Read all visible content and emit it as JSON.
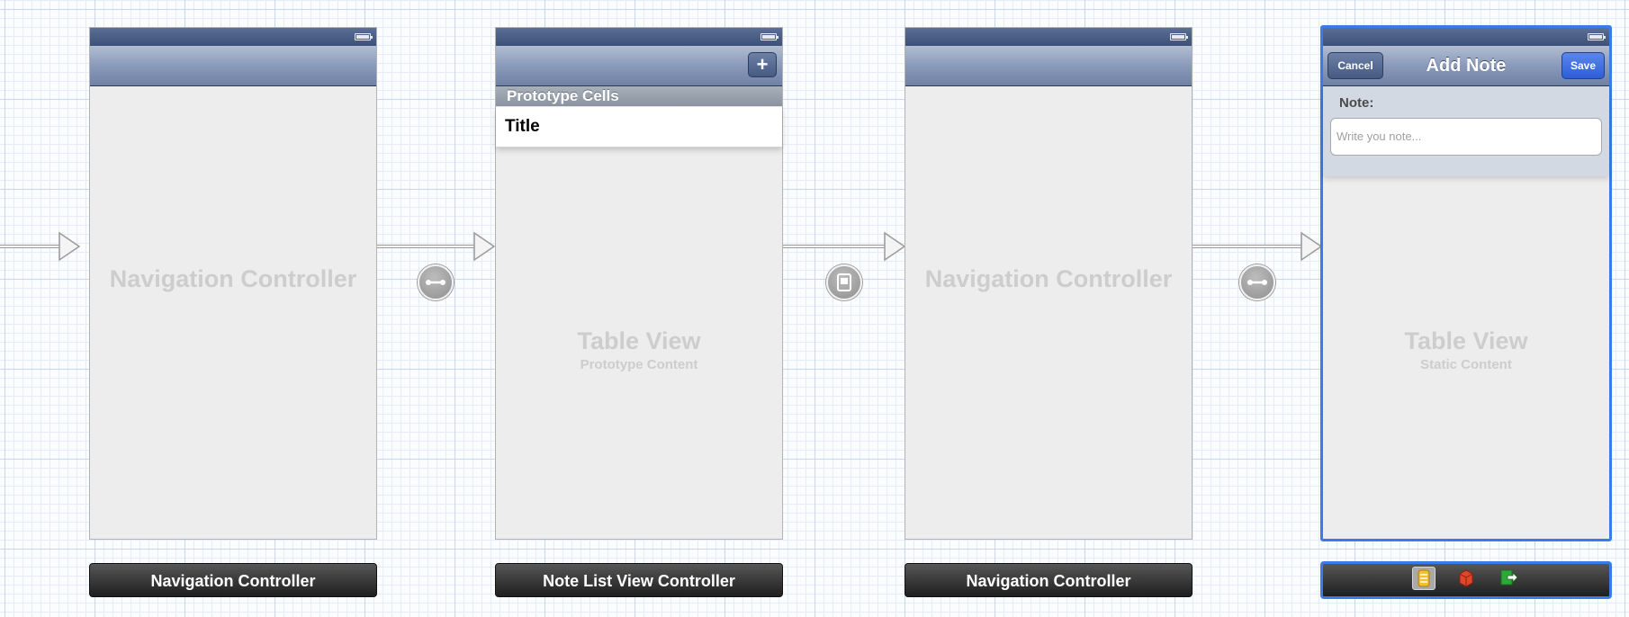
{
  "scenes": {
    "nav1": {
      "center_label": "Navigation Controller",
      "dock_label": "Navigation Controller"
    },
    "notelist": {
      "prototype_header": "Prototype Cells",
      "cell_title": "Title",
      "add_button": "+",
      "table_title": "Table View",
      "table_subtitle": "Prototype Content",
      "dock_label": "Note List View Controller"
    },
    "nav2": {
      "center_label": "Navigation Controller",
      "dock_label": "Navigation Controller"
    },
    "addnote": {
      "nav_title": "Add Note",
      "cancel_label": "Cancel",
      "save_label": "Save",
      "note_label": "Note:",
      "note_placeholder": "Write you note...",
      "table_title": "Table View",
      "table_subtitle": "Static Content"
    }
  },
  "segues": [
    {
      "type": "relationship",
      "icon": "relationship-segue-icon"
    },
    {
      "type": "modal",
      "icon": "modal-segue-icon"
    },
    {
      "type": "relationship",
      "icon": "relationship-segue-icon"
    }
  ],
  "dock_icons": [
    "view-controller-icon",
    "first-responder-icon",
    "exit-icon"
  ],
  "colors": {
    "selection": "#3b7ae8",
    "navbar": "#8a9abb",
    "save_button": "#2d5ed8"
  }
}
